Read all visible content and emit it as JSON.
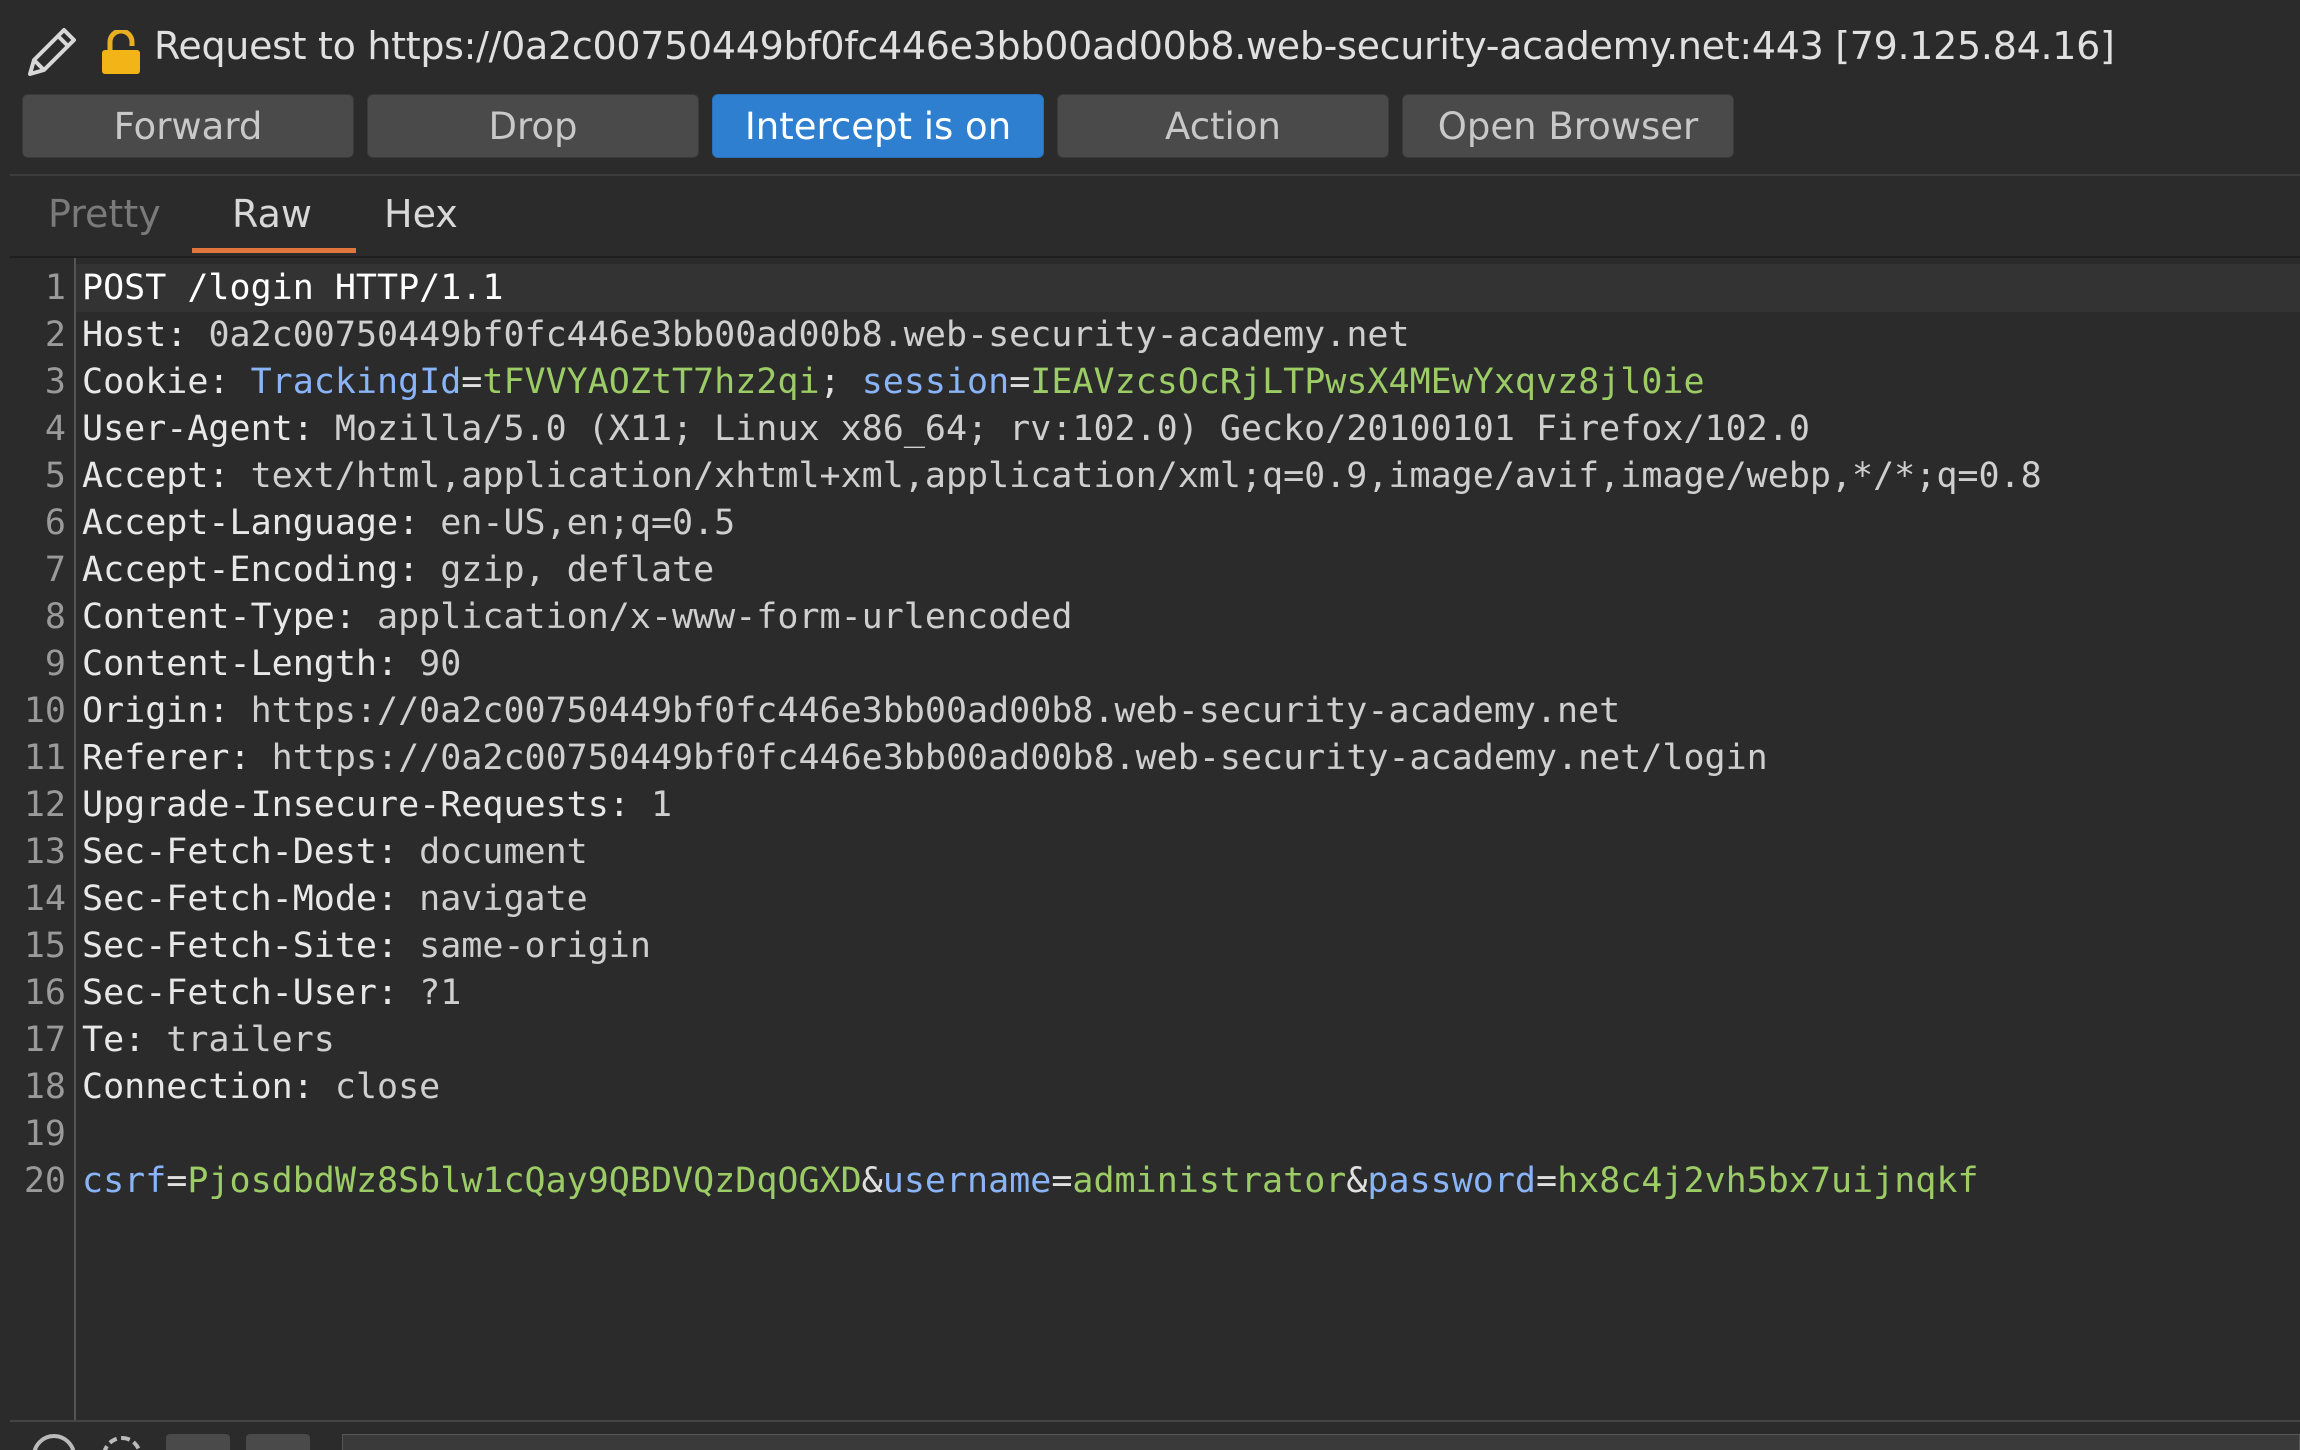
{
  "request_bar": {
    "title": "Request to https://0a2c00750449bf0fc446e3bb00ad00b8.web-security-academy.net:443  [79.125.84.16]",
    "edit_icon": "pencil-icon",
    "lock_icon": "lock-icon"
  },
  "toolbar": {
    "forward_label": "Forward",
    "drop_label": "Drop",
    "intercept_label": "Intercept is on",
    "action_label": "Action",
    "open_browser_label": "Open Browser"
  },
  "tabs": {
    "pretty_label": "Pretty",
    "raw_label": "Raw",
    "hex_label": "Hex",
    "active": "Raw"
  },
  "colors": {
    "accent_blue": "#2f7fd0",
    "tab_underline": "#e0763e",
    "cookie_name": "#8ab4f8",
    "cookie_value": "#9ccc65"
  },
  "editor": {
    "lines": [
      {
        "n": "1",
        "parts": [
          {
            "t": "POST /login HTTP/1.1",
            "c": "method"
          }
        ]
      },
      {
        "n": "2",
        "parts": [
          {
            "t": "Host: ",
            "c": "hdr-name"
          },
          {
            "t": "0a2c00750449bf0fc446e3bb00ad00b8.web-security-academy.net",
            "c": "hdr-val"
          }
        ]
      },
      {
        "n": "3",
        "parts": [
          {
            "t": "Cookie: ",
            "c": "hdr-name"
          },
          {
            "t": "TrackingId",
            "c": "ck-name"
          },
          {
            "t": "=",
            "c": "punct"
          },
          {
            "t": "tFVVYAOZtT7hz2qi",
            "c": "ck-val"
          },
          {
            "t": "; ",
            "c": "punct"
          },
          {
            "t": "session",
            "c": "ck-name"
          },
          {
            "t": "=",
            "c": "punct"
          },
          {
            "t": "IEAVzcsOcRjLTPwsX4MEwYxqvz8jl0ie",
            "c": "ck-val"
          }
        ]
      },
      {
        "n": "4",
        "parts": [
          {
            "t": "User-Agent: ",
            "c": "hdr-name"
          },
          {
            "t": "Mozilla/5.0 (X11; Linux x86_64; rv:102.0) Gecko/20100101 Firefox/102.0",
            "c": "hdr-val"
          }
        ]
      },
      {
        "n": "5",
        "parts": [
          {
            "t": "Accept: ",
            "c": "hdr-name"
          },
          {
            "t": "text/html,application/xhtml+xml,application/xml;q=0.9,image/avif,image/webp,*/*;q=0.8",
            "c": "hdr-val"
          }
        ]
      },
      {
        "n": "6",
        "parts": [
          {
            "t": "Accept-Language: ",
            "c": "hdr-name"
          },
          {
            "t": "en-US,en;q=0.5",
            "c": "hdr-val"
          }
        ]
      },
      {
        "n": "7",
        "parts": [
          {
            "t": "Accept-Encoding: ",
            "c": "hdr-name"
          },
          {
            "t": "gzip, deflate",
            "c": "hdr-val"
          }
        ]
      },
      {
        "n": "8",
        "parts": [
          {
            "t": "Content-Type: ",
            "c": "hdr-name"
          },
          {
            "t": "application/x-www-form-urlencoded",
            "c": "hdr-val"
          }
        ]
      },
      {
        "n": "9",
        "parts": [
          {
            "t": "Content-Length: ",
            "c": "hdr-name"
          },
          {
            "t": "90",
            "c": "hdr-val"
          }
        ]
      },
      {
        "n": "10",
        "parts": [
          {
            "t": "Origin: ",
            "c": "hdr-name"
          },
          {
            "t": "https://0a2c00750449bf0fc446e3bb00ad00b8.web-security-academy.net",
            "c": "hdr-val"
          }
        ]
      },
      {
        "n": "11",
        "parts": [
          {
            "t": "Referer: ",
            "c": "hdr-name"
          },
          {
            "t": "https://0a2c00750449bf0fc446e3bb00ad00b8.web-security-academy.net/login",
            "c": "hdr-val"
          }
        ]
      },
      {
        "n": "12",
        "parts": [
          {
            "t": "Upgrade-Insecure-Requests: ",
            "c": "hdr-name"
          },
          {
            "t": "1",
            "c": "hdr-val"
          }
        ]
      },
      {
        "n": "13",
        "parts": [
          {
            "t": "Sec-Fetch-Dest: ",
            "c": "hdr-name"
          },
          {
            "t": "document",
            "c": "hdr-val"
          }
        ]
      },
      {
        "n": "14",
        "parts": [
          {
            "t": "Sec-Fetch-Mode: ",
            "c": "hdr-name"
          },
          {
            "t": "navigate",
            "c": "hdr-val"
          }
        ]
      },
      {
        "n": "15",
        "parts": [
          {
            "t": "Sec-Fetch-Site: ",
            "c": "hdr-name"
          },
          {
            "t": "same-origin",
            "c": "hdr-val"
          }
        ]
      },
      {
        "n": "16",
        "parts": [
          {
            "t": "Sec-Fetch-User: ",
            "c": "hdr-name"
          },
          {
            "t": "?1",
            "c": "hdr-val"
          }
        ]
      },
      {
        "n": "17",
        "parts": [
          {
            "t": "Te: ",
            "c": "hdr-name"
          },
          {
            "t": "trailers",
            "c": "hdr-val"
          }
        ]
      },
      {
        "n": "18",
        "parts": [
          {
            "t": "Connection: ",
            "c": "hdr-name"
          },
          {
            "t": "close",
            "c": "hdr-val"
          }
        ]
      },
      {
        "n": "19",
        "parts": []
      },
      {
        "n": "20",
        "parts": [
          {
            "t": "csrf",
            "c": "ck-name"
          },
          {
            "t": "=",
            "c": "punct"
          },
          {
            "t": "PjosdbdWz8Sblw1cQay9QBDVQzDqOGXD",
            "c": "ck-val"
          },
          {
            "t": "&",
            "c": "punct"
          },
          {
            "t": "username",
            "c": "ck-name"
          },
          {
            "t": "=",
            "c": "punct"
          },
          {
            "t": "administrator",
            "c": "ck-val"
          },
          {
            "t": "&",
            "c": "punct"
          },
          {
            "t": "password",
            "c": "ck-name"
          },
          {
            "t": "=",
            "c": "punct"
          },
          {
            "t": "hx8c4j2vh5bx7uijnqkf",
            "c": "ck-val"
          }
        ]
      }
    ]
  }
}
